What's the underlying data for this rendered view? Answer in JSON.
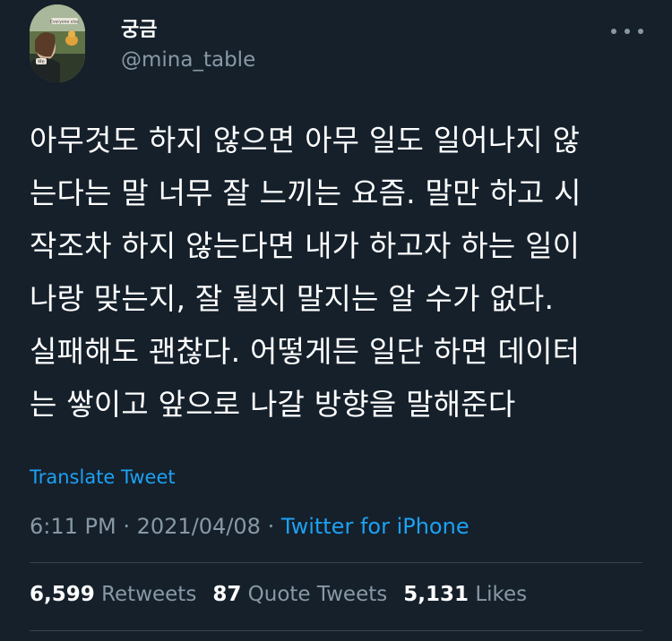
{
  "author": {
    "display_name": "궁금",
    "handle": "@mina_table",
    "avatar_caption": "Me"
  },
  "more_icon": "more-horizontal-icon",
  "tweet": {
    "text": "아무것도 하지 않으면 아무 일도 일어나지 않\n는다는 말 너무 잘 느끼는 요즘. 말만 하고 시\n작조차 하지 않는다면 내가 하고자 하는 일이\n나랑 맞는지, 잘 될지 말지는 알 수가 없다.\n실패해도 괜찮다. 어떻게든 일단 하면 데이터\n는 쌓이고 앞으로 나갈 방향을 말해준다",
    "translate_label": "Translate Tweet"
  },
  "meta": {
    "time": "6:11 PM",
    "separator": "·",
    "date": "2021/04/08",
    "source": "Twitter for iPhone"
  },
  "stats": {
    "retweets_count": "6,599",
    "retweets_label": "Retweets",
    "quotes_count": "87",
    "quotes_label": "Quote Tweets",
    "likes_count": "5,131",
    "likes_label": "Likes"
  },
  "colors": {
    "background": "#15202b",
    "text_primary": "#ffffff",
    "text_secondary": "#8899a6",
    "link": "#1da1f2",
    "divider": "#38444d"
  }
}
